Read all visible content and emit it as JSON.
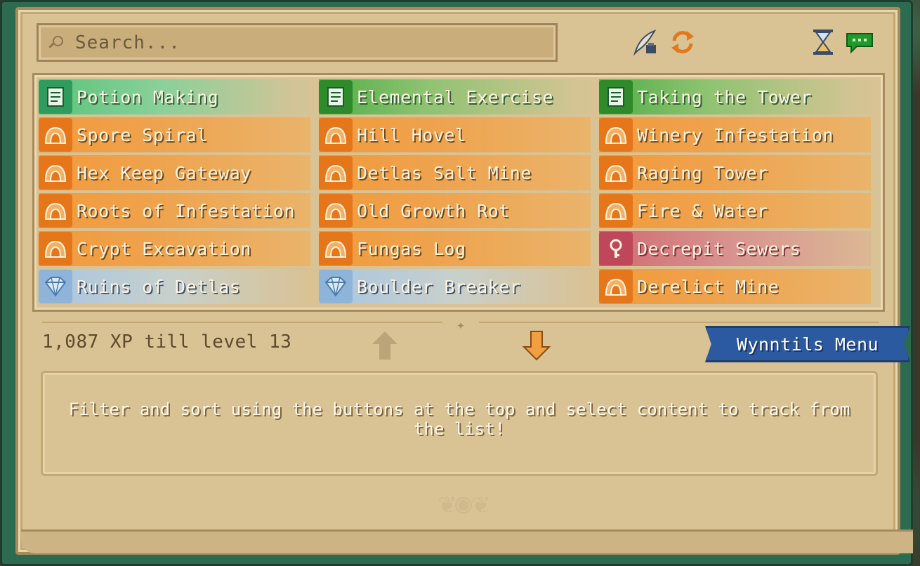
{
  "search": {
    "placeholder": "Search..."
  },
  "toolbar": {
    "icons": [
      "quill-ink-icon",
      "refresh-icon",
      "hourglass-icon",
      "chat-bubble-icon"
    ]
  },
  "content": [
    {
      "label": "Potion Making",
      "type": "green-scroll"
    },
    {
      "label": "Elemental Exercise",
      "type": "green2-scroll"
    },
    {
      "label": "Taking the Tower",
      "type": "green2-scroll"
    },
    {
      "label": "Spore Spiral",
      "type": "orange-cave"
    },
    {
      "label": "Hill Hovel",
      "type": "orange-cave"
    },
    {
      "label": "Winery Infestation",
      "type": "orange-cave"
    },
    {
      "label": "Hex Keep Gateway",
      "type": "orange-cave"
    },
    {
      "label": "Detlas Salt Mine",
      "type": "orange-cave"
    },
    {
      "label": "Raging Tower",
      "type": "orange-cave"
    },
    {
      "label": "Roots of Infestation",
      "type": "orange-cave"
    },
    {
      "label": "Old Growth Rot",
      "type": "orange-cave"
    },
    {
      "label": "Fire & Water",
      "type": "orange-cave"
    },
    {
      "label": "Crypt Excavation",
      "type": "orange-cave"
    },
    {
      "label": "Fungas Log",
      "type": "orange-cave"
    },
    {
      "label": "Decrepit Sewers",
      "type": "red-dungeon"
    },
    {
      "label": "Ruins of Detlas",
      "type": "blue-gem"
    },
    {
      "label": "Boulder Breaker",
      "type": "blue-gem"
    },
    {
      "label": "Derelict Mine",
      "type": "orange-cave"
    }
  ],
  "footer": {
    "xp_text": "1,087 XP till level 13",
    "menu_label": "Wynntils Menu",
    "info_text": "Filter and sort using the buttons at the top and select content to track from the list!"
  },
  "colors": {
    "orange": "#f29a3c",
    "green": "#58c37a",
    "red": "#d06a70",
    "blue": "#a8c6e2",
    "banner": "#2b5aa0"
  }
}
